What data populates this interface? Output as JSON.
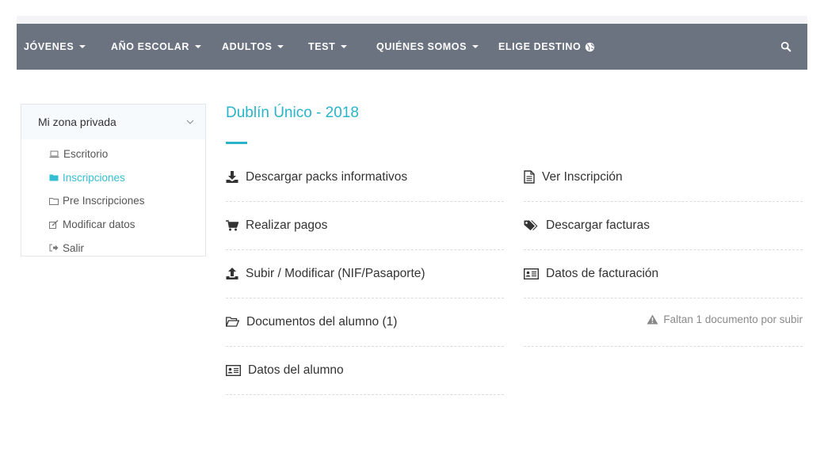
{
  "nav": {
    "items": [
      {
        "label": "JÓVENES",
        "dropdown": true
      },
      {
        "label": "AÑO ESCOLAR",
        "dropdown": true
      },
      {
        "label": "ADULTOS",
        "dropdown": true
      },
      {
        "label": "TEST",
        "dropdown": true
      },
      {
        "label": "QUIÉNES SOMOS",
        "dropdown": true
      },
      {
        "label": "ELIGE DESTINO",
        "dropdown": false
      }
    ],
    "search_icon": "search-icon",
    "globe_icon": "globe-icon"
  },
  "sidebar": {
    "header": "Mi zona privada",
    "items": [
      {
        "label": "Escritorio",
        "icon": "laptop-icon",
        "active": false
      },
      {
        "label": "Inscripciones",
        "icon": "folder-filled-icon",
        "active": true
      },
      {
        "label": "Pre Inscripciones",
        "icon": "folder-outline-icon",
        "active": false
      },
      {
        "label": "Modificar datos",
        "icon": "edit-icon",
        "active": false
      },
      {
        "label": "Salir",
        "icon": "sign-out-icon",
        "active": false
      }
    ]
  },
  "main": {
    "title": "Dublín Único - 2018",
    "actions": [
      {
        "label": "Descargar packs informativos",
        "icon": "download-icon"
      },
      {
        "label": "Ver Inscripción",
        "icon": "document-icon"
      },
      {
        "label": "Realizar pagos",
        "icon": "cart-icon"
      },
      {
        "label": "Descargar facturas",
        "icon": "tags-icon"
      },
      {
        "label": "Subir / Modificar (NIF/Pasaporte)",
        "icon": "upload-icon"
      },
      {
        "label": "Datos de facturación",
        "icon": "id-card-icon"
      },
      {
        "label": "Documentos del alumno (1)",
        "icon": "folder-open-icon"
      },
      {
        "label": "Datos del alumno",
        "icon": "id-card-icon"
      }
    ],
    "warning": "Faltan 1 documento por subir"
  },
  "colors": {
    "navbar": "#6b7280",
    "accent": "#29b4c9",
    "active_link": "#34bed3"
  }
}
